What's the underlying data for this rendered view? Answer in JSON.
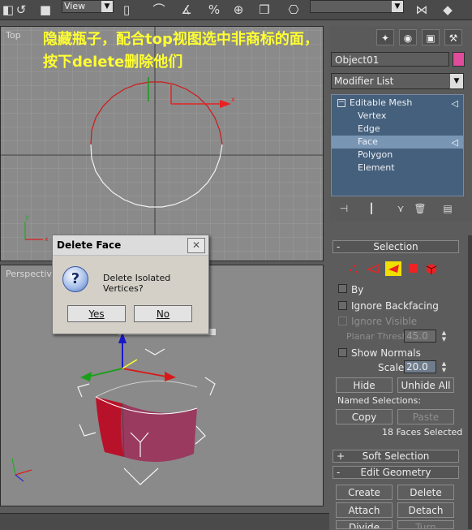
{
  "toolbar": {
    "view_dropdown": "View",
    "icons": [
      "undo-icon",
      "select-region-icon",
      "link-icon",
      "snap-3d-icon",
      "angle-snap-icon",
      "percent-snap-icon",
      "spinner-snap-icon",
      "edit-named-sets-icon",
      "mirror-icon",
      "align-icon"
    ]
  },
  "viewports": {
    "top_label": "Top",
    "perspective_label": "Perspective"
  },
  "annotation": {
    "line1": "隐藏瓶子，配合top视图选中非商标的面，",
    "line2": "按下delete删除他们"
  },
  "dialog": {
    "title": "Delete Face",
    "message": "Delete Isolated Vertices?",
    "yes_label": "Yes",
    "no_label": "No",
    "close_symbol": "✕"
  },
  "command_panel": {
    "object_name": "Object01",
    "object_color": "#e04b9b",
    "modifier_list_label": "Modifier List",
    "stack": {
      "root": "Editable Mesh",
      "items": [
        "Vertex",
        "Edge",
        "Face",
        "Polygon",
        "Element"
      ],
      "selected": "Face"
    }
  },
  "selection": {
    "rollout_title": "Selection",
    "by_label": "By",
    "ignore_backfacing_label": "Ignore Backfacing",
    "ignore_visible_label": "Ignore Visible",
    "planar_thresh_label": "Planar Thresh:",
    "planar_thresh_value": "45.0",
    "show_normals_label": "Show Normals",
    "scale_label": "Scale:",
    "scale_value": "20.0",
    "hide_label": "Hide",
    "unhide_all_label": "Unhide All",
    "named_selections_label": "Named Selections:",
    "copy_label": "Copy",
    "paste_label": "Paste",
    "status": "18 Faces Selected"
  },
  "soft_selection": {
    "title": "Soft Selection",
    "sign": "+"
  },
  "edit_geometry": {
    "title": "Edit Geometry",
    "sign": "-",
    "create_label": "Create",
    "delete_label": "Delete",
    "attach_label": "Attach",
    "detach_label": "Detach",
    "divide_label": "Divide",
    "turn_label": "Turn"
  },
  "colors": {
    "viewport_bg": "#8a8a8a",
    "selected_stack_bg": "#7896b4",
    "annotation": "#ffff33",
    "face_selection_color": "#cc0000"
  }
}
